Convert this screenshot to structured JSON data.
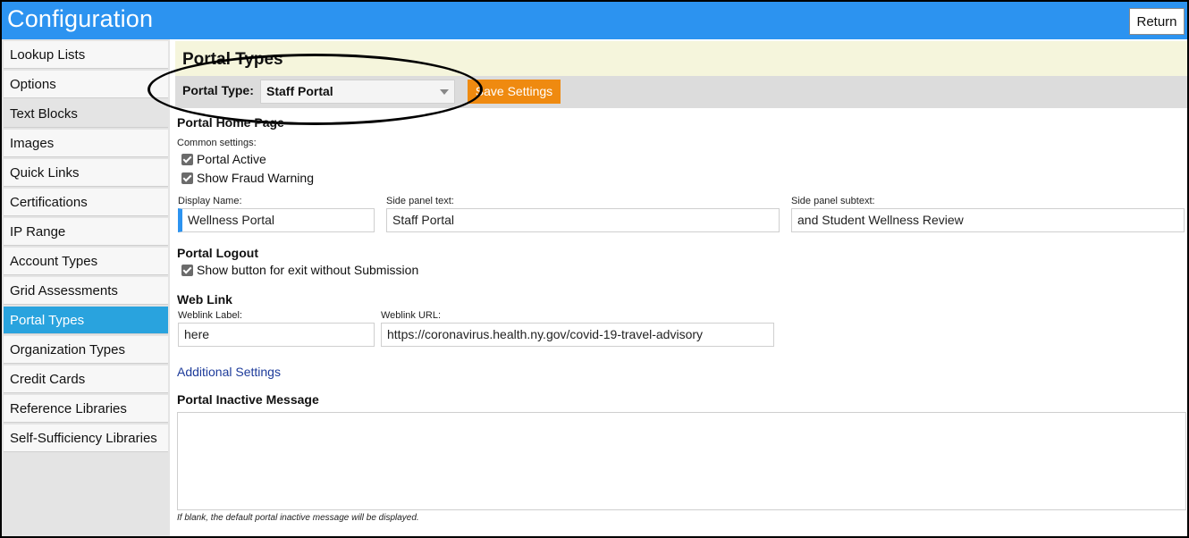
{
  "app": {
    "title": "Configuration",
    "return_label": "Return"
  },
  "sidebar": {
    "items": [
      {
        "label": "Lookup Lists"
      },
      {
        "label": "Options"
      },
      {
        "label": "Text Blocks"
      },
      {
        "label": "Images"
      },
      {
        "label": "Quick Links"
      },
      {
        "label": "Certifications"
      },
      {
        "label": "IP Range"
      },
      {
        "label": "Account Types"
      },
      {
        "label": "Grid Assessments"
      },
      {
        "label": "Portal Types"
      },
      {
        "label": "Organization Types"
      },
      {
        "label": "Credit Cards"
      },
      {
        "label": "Reference Libraries"
      },
      {
        "label": "Self-Sufficiency Libraries"
      }
    ],
    "active": "Portal Types"
  },
  "page": {
    "title": "Portal Types"
  },
  "toolbar": {
    "portal_type_label": "Portal Type:",
    "portal_type_value": "Staff Portal",
    "save_label": "Save Settings"
  },
  "home": {
    "title": "Portal Home Page",
    "common_label": "Common settings:",
    "portal_active_label": "Portal Active",
    "show_fraud_label": "Show Fraud Warning",
    "display_name_label": "Display Name:",
    "display_name_value": "Wellness Portal",
    "side_text_label": "Side panel text:",
    "side_text_value": "Staff Portal",
    "side_subtext_label": "Side panel subtext:",
    "side_subtext_value": "and Student Wellness Review"
  },
  "logout": {
    "title": "Portal Logout",
    "exit_label": "Show button for exit without Submission"
  },
  "weblink": {
    "title": "Web Link",
    "label_label": "Weblink Label:",
    "label_value": "here",
    "url_label": "Weblink URL:",
    "url_value": "https://coronavirus.health.ny.gov/covid-19-travel-advisory"
  },
  "additional": {
    "link_label": "Additional Settings"
  },
  "inactive": {
    "title": "Portal Inactive Message",
    "hint": "If blank, the default portal inactive message will be displayed."
  },
  "colors": {
    "topbar": "#2c93f0",
    "active_item": "#29a3de",
    "save_button": "#ef8a10",
    "header_bg": "#f5f5dc"
  }
}
